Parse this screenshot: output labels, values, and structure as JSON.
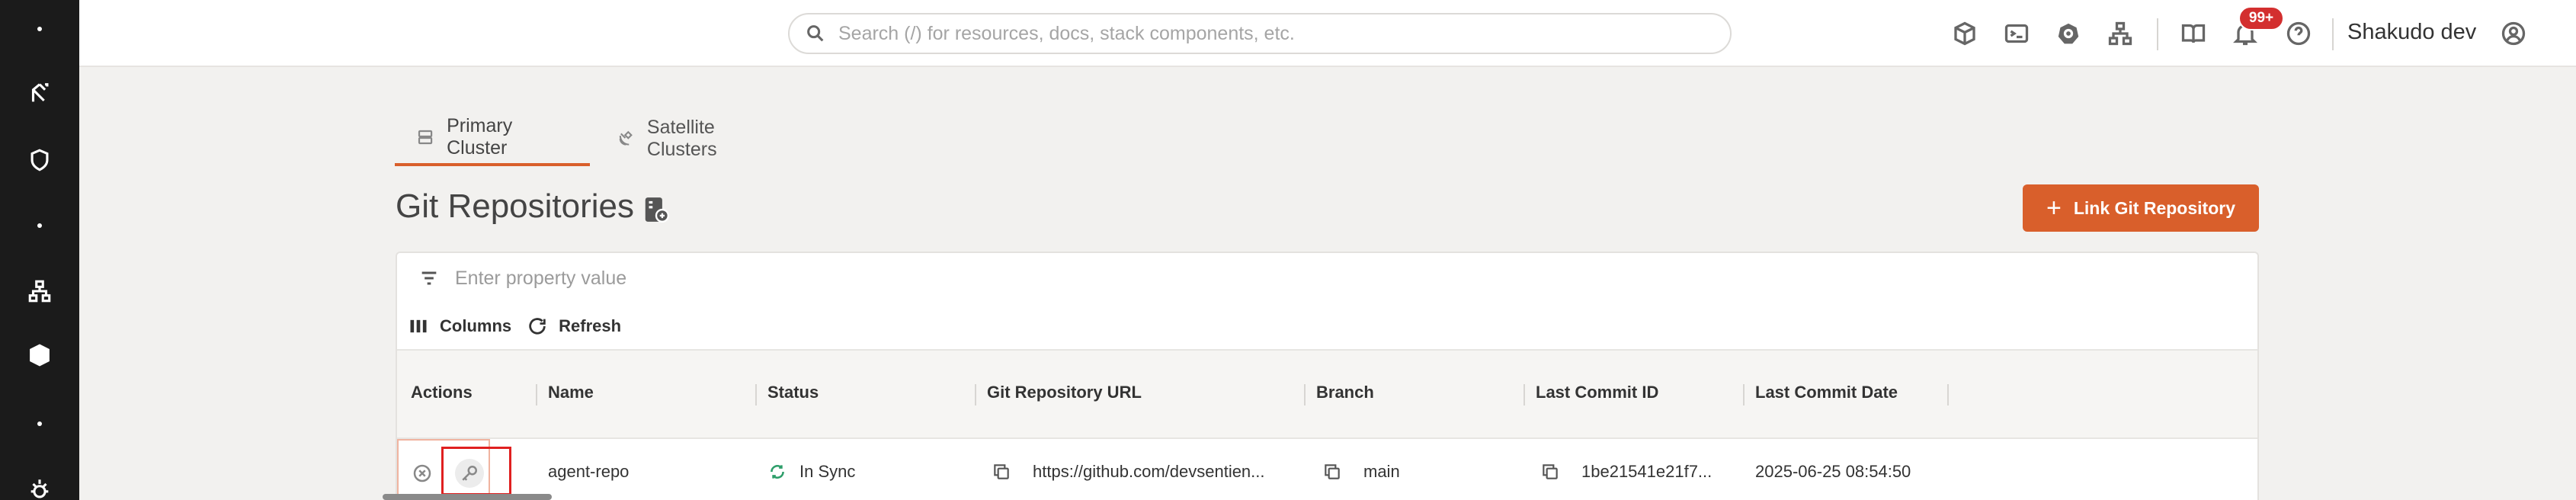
{
  "sidebar": {
    "items": [
      {
        "icon": "dot-icon"
      },
      {
        "icon": "git-branch-icon"
      },
      {
        "icon": "shield-icon"
      },
      {
        "icon": "dot-icon"
      },
      {
        "icon": "network-icon"
      },
      {
        "icon": "layers-icon"
      },
      {
        "icon": "dot-icon"
      },
      {
        "icon": "bug-icon"
      }
    ]
  },
  "header": {
    "search_placeholder": "Search (/) for resources, docs, stack components, etc.",
    "notification_badge": "99+",
    "user_name": "Shakudo dev"
  },
  "tabs": [
    {
      "label": "Primary Cluster",
      "active": true
    },
    {
      "label": "Satellite Clusters",
      "active": false
    }
  ],
  "page": {
    "title": "Git Repositories",
    "link_button_label": "Link Git Repository"
  },
  "filter": {
    "placeholder": "Enter property value"
  },
  "toolbar": {
    "columns_label": "Columns",
    "refresh_label": "Refresh"
  },
  "table": {
    "columns": [
      "Actions",
      "Name",
      "Status",
      "Git Repository URL",
      "Branch",
      "Last Commit ID",
      "Last Commit Date"
    ],
    "rows": [
      {
        "name": "agent-repo",
        "status": "In Sync",
        "url": "https://github.com/devsentien...",
        "branch": "main",
        "commit_id": "1be21541e21f7...",
        "commit_date": "2025-06-25 08:54:50"
      }
    ]
  },
  "colors": {
    "accent": "#d95f2b",
    "sidebar_bg": "#1b1b1b",
    "page_bg": "#f2f1ef",
    "badge": "#d32f2f",
    "status_ok": "#2e9e6a"
  }
}
